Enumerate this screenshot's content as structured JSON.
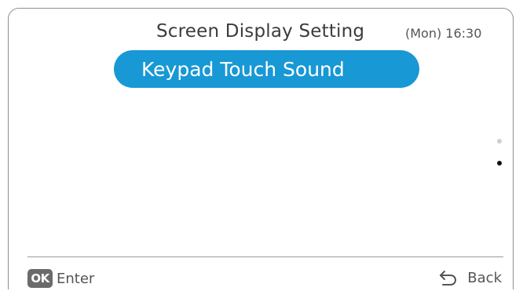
{
  "header": {
    "title": "Screen Display Setting",
    "clock": "(Mon) 16:30"
  },
  "menu": {
    "selected_item": "Keypad Touch Sound"
  },
  "pagination": {
    "pages": 2,
    "current_page": 2
  },
  "footer": {
    "ok_badge": "OK",
    "enter_label": "Enter",
    "back_label": "Back",
    "back_icon": "return-arrow-icon"
  },
  "colors": {
    "accent": "#1898d5",
    "text": "#3c3c3c",
    "badge": "#6b6b6b"
  }
}
